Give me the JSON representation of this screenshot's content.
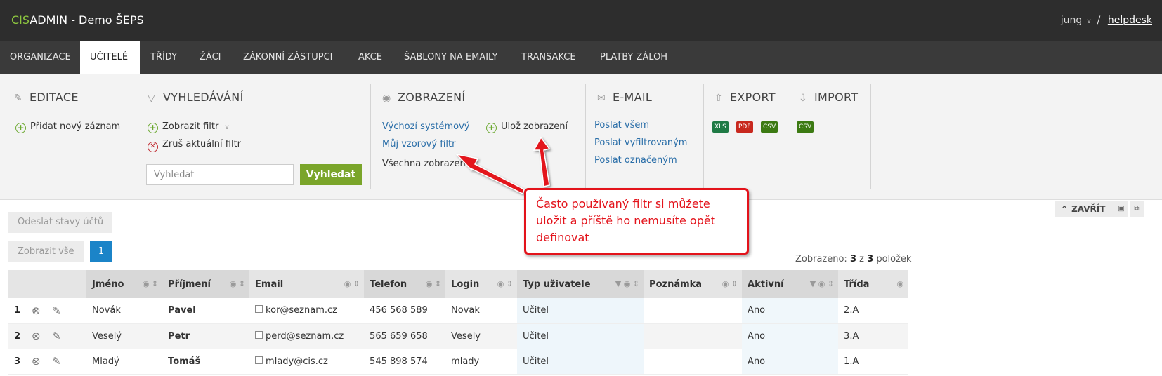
{
  "header": {
    "brand_cis": "CIS",
    "brand_rest": "ADMIN - Demo ŠEPS",
    "user": "jung",
    "separator": "/",
    "helpdesk": "helpdesk"
  },
  "nav": [
    "ORGANIZACE",
    "UČITELÉ",
    "TŘÍDY",
    "ŽÁCI",
    "ZÁKONNÍ ZÁSTUPCI",
    "AKCE",
    "ŠABLONY NA EMAILY",
    "TRANSAKCE",
    "PLATBY ZÁLOH"
  ],
  "editace": {
    "title": "EDITACE",
    "add": "Přidat nový záznam"
  },
  "vyhledavani": {
    "title": "VYHLEDÁVÁNÍ",
    "show_filter": "Zobrazit filtr",
    "clear_filter": "Zruš aktuální filtr",
    "search_placeholder": "Vyhledat",
    "search_button": "Vyhledat"
  },
  "zobrazeni": {
    "title": "ZOBRAZENÍ",
    "default": "Výchozí systémový",
    "save": "Ulož zobrazení",
    "my_filter": "Můj vzorový filtr",
    "all": "Všechna zobrazení"
  },
  "email": {
    "title": "E-MAIL",
    "all": "Poslat všem",
    "filtered": "Poslat vyfiltrovaným",
    "marked": "Poslat označeným"
  },
  "export": {
    "title": "EXPORT",
    "formats": [
      "XLS",
      "PDF",
      "CSV"
    ]
  },
  "import": {
    "title": "IMPORT",
    "formats": [
      "CSV"
    ]
  },
  "actions": {
    "send_states": "Odeslat stavy účtů",
    "show_all": "Zobrazit vše",
    "page": "1",
    "close": "ZAVŘÍT"
  },
  "count": {
    "prefix": "Zobrazeno:",
    "shown": "3",
    "of": "z",
    "total": "3",
    "suffix": "položek"
  },
  "table": {
    "columns": [
      "Jméno",
      "Příjmení",
      "Email",
      "Telefon",
      "Login",
      "Typ uživatele",
      "Poznámka",
      "Aktivní",
      "Třída"
    ],
    "rows": [
      {
        "n": "1",
        "jmeno": "Novák",
        "prijmeni": "Pavel",
        "email": "kor@seznam.cz",
        "telefon": "456 568 589",
        "login": "Novak",
        "typ": "Učitel",
        "poznamka": "",
        "aktivni": "Ano",
        "trida": "2.A"
      },
      {
        "n": "2",
        "jmeno": "Veselý",
        "prijmeni": "Petr",
        "email": "perd@seznam.cz",
        "telefon": "565 659 658",
        "login": "Vesely",
        "typ": "Učitel",
        "poznamka": "",
        "aktivni": "Ano",
        "trida": "3.A"
      },
      {
        "n": "3",
        "jmeno": "Mladý",
        "prijmeni": "Tomáš",
        "email": "mlady@cis.cz",
        "telefon": "545 898 574",
        "login": "mlady",
        "typ": "Učitel",
        "poznamka": "",
        "aktivni": "Ano",
        "trida": "1.A"
      }
    ]
  },
  "callout": {
    "text": "Často používaný filtr si můžete uložit a příště ho nemusíte opět definovat"
  },
  "colors": {
    "accent_green": "#8dc63f",
    "button_green": "#7aa52a",
    "link_blue": "#2a6ea8",
    "callout_red": "#e3131b",
    "page_blue": "#1b84c8"
  }
}
